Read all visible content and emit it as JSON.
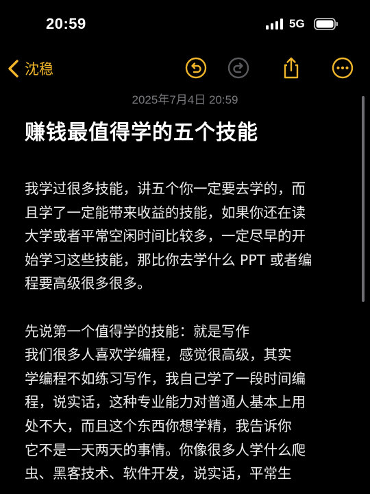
{
  "status_bar": {
    "time": "20:59",
    "network": "5G",
    "signal_icon": "cellular-signal-icon",
    "battery_icon": "battery-icon"
  },
  "nav": {
    "back_label": "沈稳",
    "accent_color": "#f0b52a",
    "icons": [
      "undo-icon",
      "redo-icon",
      "share-icon",
      "more-icon"
    ]
  },
  "note": {
    "date": "2025年7月4日 20:59",
    "title": "赚钱最值得学的五个技能",
    "lines": [
      "我学过很多技能，讲五个你一定要去学的，而",
      "且学了一定能带来收益的技能，如果你还在读",
      "大学或者平常空闲时间比较多，一定尽早的开",
      "始学习这些技能，那比你去学什么 PPT 或者编",
      "程要高级很多很多。",
      "",
      "先说第一个值得学的技能：就是写作",
      "我们很多人喜欢学编程，感觉很高级，其实",
      "学编程不如练习写作，我自己学了一段时间编",
      "程，说实话，这种专业能力对普通人基本上用",
      "处不大，而且这个东西你想学精，我告诉你",
      "它不是一天两天的事情。你像很多人学什么爬",
      "虫、黑客技术、软件开发，说实话，平常生"
    ]
  }
}
